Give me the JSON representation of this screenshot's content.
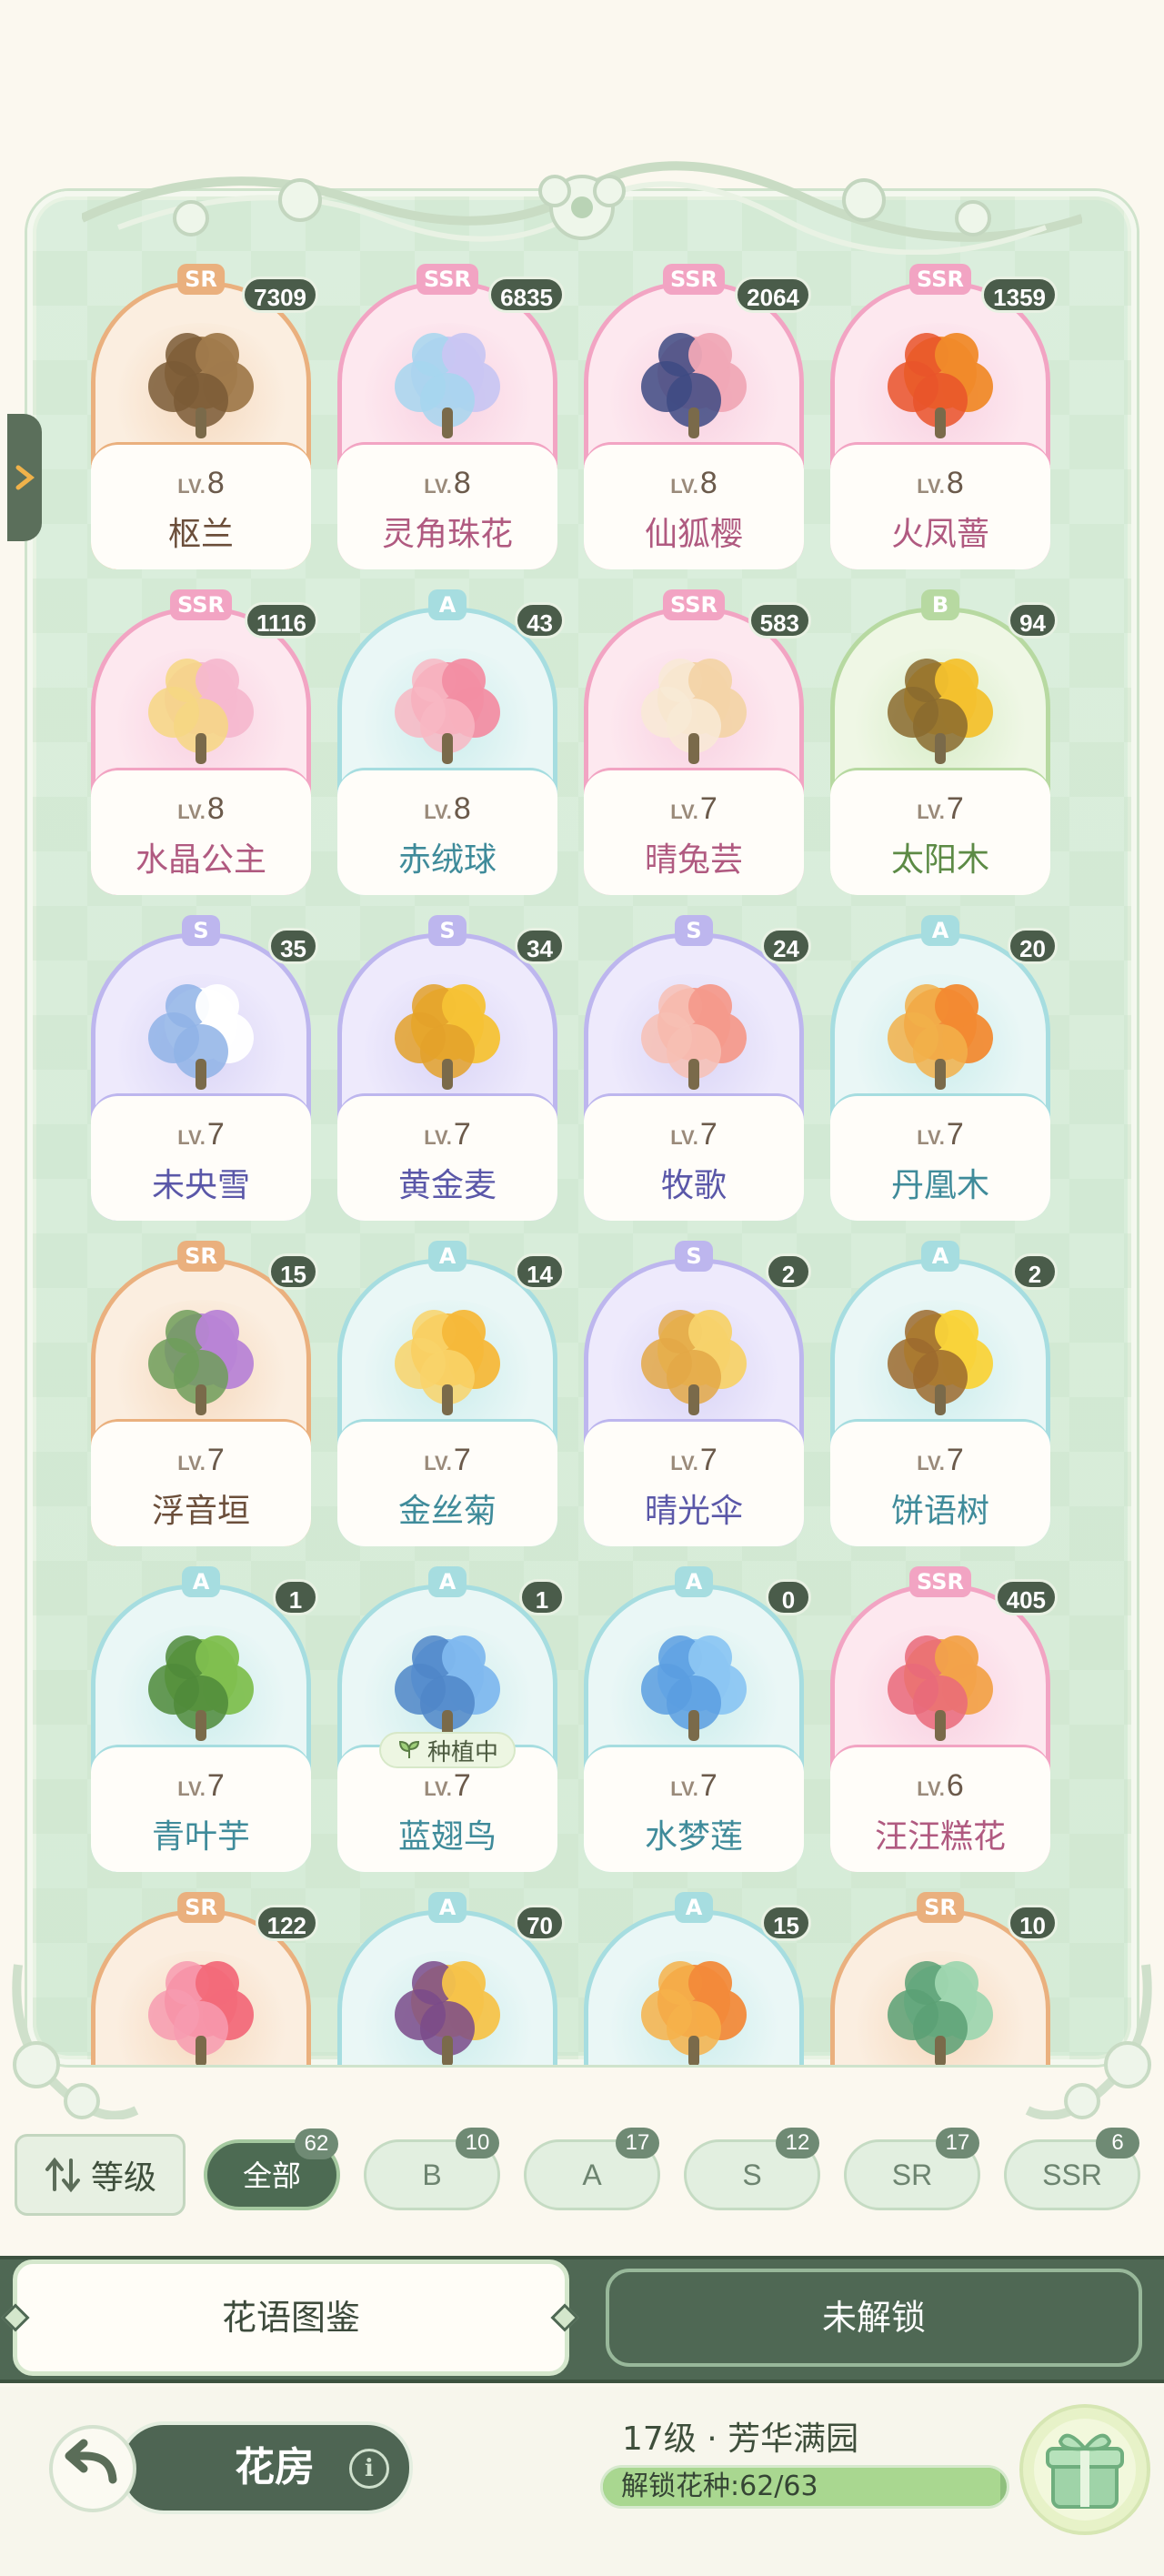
{
  "side_tab": {
    "icon": "chevron-right-icon"
  },
  "flowers": [
    {
      "rarity": "SR",
      "count": "7309",
      "lv_prefix": "LV.",
      "level": "8",
      "name": "枢兰",
      "art": "deity-statue"
    },
    {
      "rarity": "SSR",
      "count": "6835",
      "lv_prefix": "LV.",
      "level": "8",
      "name": "灵角珠花",
      "art": "unicorn"
    },
    {
      "rarity": "SSR",
      "count": "2064",
      "lv_prefix": "LV.",
      "level": "8",
      "name": "仙狐樱",
      "art": "fox"
    },
    {
      "rarity": "SSR",
      "count": "1359",
      "lv_prefix": "LV.",
      "level": "8",
      "name": "火凤蔷",
      "art": "phoenix"
    },
    {
      "rarity": "SSR",
      "count": "1116",
      "lv_prefix": "LV.",
      "level": "8",
      "name": "水晶公主",
      "art": "princess"
    },
    {
      "rarity": "A",
      "count": "43",
      "lv_prefix": "LV.",
      "level": "8",
      "name": "赤绒球",
      "art": "pink-bush"
    },
    {
      "rarity": "SSR",
      "count": "583",
      "lv_prefix": "LV.",
      "level": "7",
      "name": "晴兔芸",
      "art": "rabbits"
    },
    {
      "rarity": "B",
      "count": "94",
      "lv_prefix": "LV.",
      "level": "7",
      "name": "太阳木",
      "art": "sunflower-tree"
    },
    {
      "rarity": "S",
      "count": "35",
      "lv_prefix": "LV.",
      "level": "7",
      "name": "未央雪",
      "art": "white-flower"
    },
    {
      "rarity": "S",
      "count": "34",
      "lv_prefix": "LV.",
      "level": "7",
      "name": "黄金麦",
      "art": "wheat"
    },
    {
      "rarity": "S",
      "count": "24",
      "lv_prefix": "LV.",
      "level": "7",
      "name": "牧歌",
      "art": "sheep-flower"
    },
    {
      "rarity": "A",
      "count": "20",
      "lv_prefix": "LV.",
      "level": "7",
      "name": "丹凰木",
      "art": "orange-tree"
    },
    {
      "rarity": "SR",
      "count": "15",
      "lv_prefix": "LV.",
      "level": "7",
      "name": "浮音垣",
      "art": "purple-vines"
    },
    {
      "rarity": "A",
      "count": "14",
      "lv_prefix": "LV.",
      "level": "7",
      "name": "金丝菊",
      "art": "gold-mums"
    },
    {
      "rarity": "S",
      "count": "2",
      "lv_prefix": "LV.",
      "level": "7",
      "name": "晴光伞",
      "art": "jellyfish-flower"
    },
    {
      "rarity": "A",
      "count": "2",
      "lv_prefix": "LV.",
      "level": "7",
      "name": "饼语树",
      "art": "yellow-tree"
    },
    {
      "rarity": "A",
      "count": "1",
      "lv_prefix": "LV.",
      "level": "7",
      "name": "青叶芋",
      "art": "green-leaves"
    },
    {
      "rarity": "A",
      "count": "1",
      "lv_prefix": "LV.",
      "level": "7",
      "name": "蓝翅鸟",
      "art": "blue-bird-plant",
      "status": "种植中"
    },
    {
      "rarity": "A",
      "count": "0",
      "lv_prefix": "LV.",
      "level": "7",
      "name": "水梦莲",
      "art": "blue-lotus"
    },
    {
      "rarity": "SSR",
      "count": "405",
      "lv_prefix": "LV.",
      "level": "6",
      "name": "汪汪糕花",
      "art": "shiba-cake"
    },
    {
      "rarity": "SR",
      "count": "122",
      "lv_prefix": "",
      "level": "",
      "name": "",
      "art": "red-flowers"
    },
    {
      "rarity": "A",
      "count": "70",
      "lv_prefix": "",
      "level": "",
      "name": "",
      "art": "yellow-roses"
    },
    {
      "rarity": "A",
      "count": "15",
      "lv_prefix": "",
      "level": "",
      "name": "",
      "art": "orange-flowers"
    },
    {
      "rarity": "SR",
      "count": "10",
      "lv_prefix": "",
      "level": "",
      "name": "",
      "art": "green-vines"
    }
  ],
  "filters": {
    "sort_label": "等级",
    "chips": [
      {
        "label": "全部",
        "count": "62",
        "active": true
      },
      {
        "label": "B",
        "count": "10"
      },
      {
        "label": "A",
        "count": "17"
      },
      {
        "label": "S",
        "count": "12"
      },
      {
        "label": "SR",
        "count": "17"
      },
      {
        "label": "SSR",
        "count": "6"
      }
    ]
  },
  "tabs": {
    "atlas": "花语图鉴",
    "locked": "未解锁"
  },
  "bottom": {
    "house_label": "花房",
    "info_icon": "i",
    "level_text": "17级 · 芳华满园",
    "unlock_text": "解锁花种:62/63",
    "unlock_progress": 0.984
  },
  "colors": {
    "SR": "#e9a46a",
    "SSR": "#ef8fb6",
    "A": "#8fd3d6",
    "B": "#a7d08e",
    "S": "#a59ee6"
  }
}
